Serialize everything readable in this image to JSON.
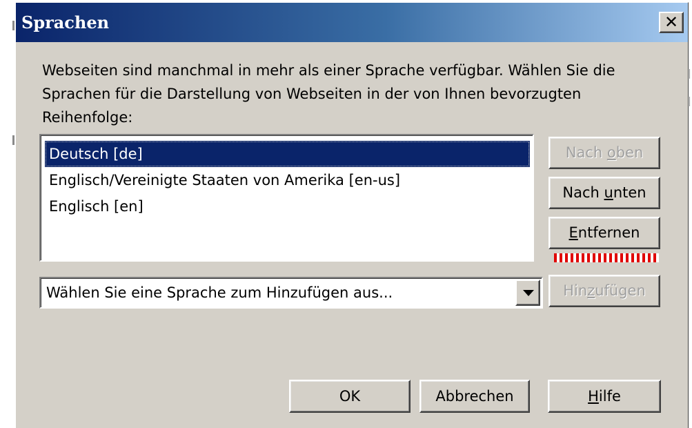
{
  "dialog": {
    "title": "Sprachen",
    "close_glyph": "✕",
    "description": "Webseiten sind manchmal in mehr als einer Sprache verfügbar. Wählen Sie die Sprachen für die Darstellung von Webseiten in der von Ihnen bevorzugten Reihenfolge:"
  },
  "languages": {
    "items": [
      {
        "label": "Deutsch  [de]",
        "selected": true
      },
      {
        "label": "Englisch/Vereinigte Staaten von Amerika  [en-us]",
        "selected": false
      },
      {
        "label": "Englisch  [en]",
        "selected": false
      }
    ]
  },
  "buttons": {
    "move_up": {
      "pre": "Nach ",
      "accel": "o",
      "post": "ben",
      "enabled": false
    },
    "move_down": {
      "pre": "Nach ",
      "accel": "u",
      "post": "nten",
      "enabled": true
    },
    "remove": {
      "pre": "",
      "accel": "E",
      "post": "ntfernen",
      "enabled": true
    },
    "add": {
      "pre": "Hin",
      "accel": "z",
      "post": "ufügen",
      "enabled": false
    },
    "ok": {
      "label": "OK"
    },
    "cancel": {
      "label": "Abbrechen"
    },
    "help": {
      "pre": "",
      "accel": "H",
      "post": "ilfe"
    }
  },
  "add_language": {
    "placeholder": "Wählen Sie eine Sprache zum Hinzufügen aus..."
  },
  "colors": {
    "title_gradient_start": "#0a246a",
    "title_gradient_end": "#a6caf0",
    "dialog_face": "#d4d0c8",
    "selection": "#0a246a",
    "marker": "#e00000"
  }
}
